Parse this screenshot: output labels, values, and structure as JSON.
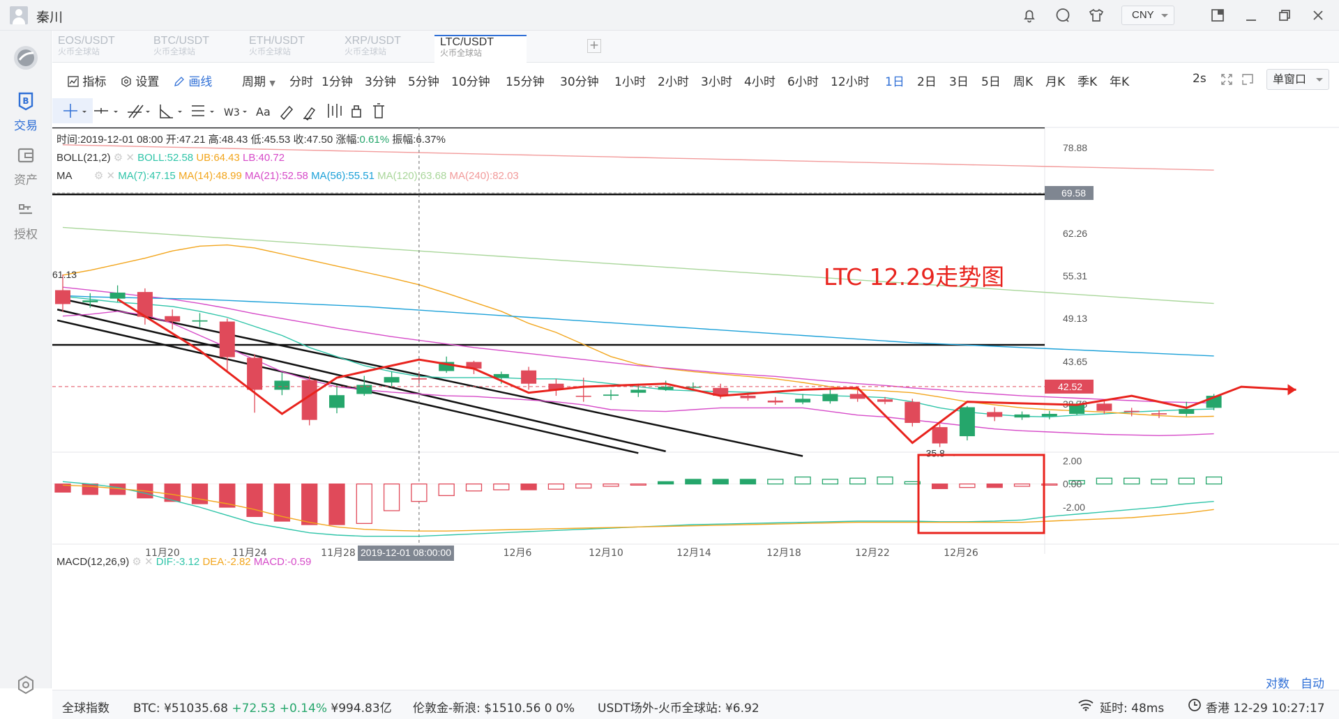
{
  "titlebar": {
    "username": "秦川",
    "currency": "CNY"
  },
  "sidebar": {
    "items": [
      {
        "label": "",
        "icon": "logo-icon"
      },
      {
        "label": "交易",
        "icon": "trade-icon"
      },
      {
        "label": "资产",
        "icon": "wallet-icon"
      },
      {
        "label": "授权",
        "icon": "key-icon"
      },
      {
        "label": "",
        "icon": "settings-hex-icon"
      }
    ]
  },
  "tabs": [
    {
      "pair": "EOS/USDT",
      "exchange": "火币全球站"
    },
    {
      "pair": "BTC/USDT",
      "exchange": "火币全球站"
    },
    {
      "pair": "ETH/USDT",
      "exchange": "火币全球站"
    },
    {
      "pair": "XRP/USDT",
      "exchange": "火币全球站"
    },
    {
      "pair": "LTC/USDT",
      "exchange": "火币全球站"
    }
  ],
  "toolbar": {
    "indicator": "指标",
    "settings": "设置",
    "draw": "画线",
    "period_label": "周期",
    "periods": [
      "分时",
      "1分钟",
      "3分钟",
      "5分钟",
      "10分钟",
      "15分钟",
      "30分钟",
      "1小时",
      "2小时",
      "3小时",
      "4小时",
      "6小时",
      "12小时",
      "1日",
      "2日",
      "3日",
      "5日",
      "周K",
      "月K",
      "季K",
      "年K"
    ],
    "active_period": "1日",
    "refresh": "2s",
    "window_mode": "单窗口"
  },
  "info": {
    "time": "时间:2019-12-01 08:00",
    "open": "开:47.21",
    "high": "高:48.43",
    "low": "低:45.53",
    "close": "收:47.50",
    "change_label": "涨幅:",
    "change": "0.61%",
    "amplitude": "振幅:6.37%"
  },
  "boll": {
    "name": "BOLL(21,2)",
    "boll": "BOLL:52.58",
    "ub": "UB:64.43",
    "lb": "LB:40.72"
  },
  "ma": {
    "name": "MA",
    "values": [
      "MA(7):47.15",
      "MA(14):48.99",
      "MA(21):52.58",
      "MA(56):55.51",
      "MA(120):63.68",
      "MA(240):82.03"
    ]
  },
  "macd": {
    "name": "MACD(12,26,9)",
    "dif": "DIF:-3.12",
    "dea": "DEA:-2.82",
    "macd": "MACD:-0.59"
  },
  "annotation": "LTC 12.29走势图",
  "colors": {
    "up": "#25a66b",
    "down": "#e04a5a",
    "accent": "#2f6fd6",
    "annotation": "#e8231d",
    "ma7": "#2ec4a8",
    "ma14": "#f2a51c",
    "ma21": "#d64ac8",
    "ma56": "#1aa0d8",
    "ma120": "#a9d69a",
    "ma240": "#f29a9a"
  },
  "chart_data": {
    "type": "candlestick",
    "price_axis": [
      "78.88",
      "69.58",
      "62.26",
      "55.31",
      "49.13",
      "43.65",
      "38.78"
    ],
    "current_price": "42.52",
    "macd_axis": [
      "2.00",
      "0.00",
      "-2.00"
    ],
    "x_labels": [
      "11月20",
      "11月24",
      "11月28",
      "12月6",
      "12月10",
      "12月14",
      "12月18",
      "12月22",
      "12月26"
    ],
    "crosshair_time": "2019-12-01 08:00:00",
    "high_label": "61.13",
    "low_label": "35.8 →",
    "ylim": [
      32,
      82
    ],
    "candles": [
      [
        58.5,
        56.2,
        61.1,
        54.9
      ],
      [
        56.5,
        56.8,
        58.0,
        55.6
      ],
      [
        57.1,
        58.1,
        59.3,
        56.5
      ],
      [
        58.2,
        54.1,
        58.8,
        52.8
      ],
      [
        54.2,
        53.3,
        55.3,
        52.0
      ],
      [
        53.3,
        53.5,
        54.7,
        52.4
      ],
      [
        53.3,
        47.4,
        53.8,
        45.1
      ],
      [
        47.3,
        42.0,
        47.9,
        38.2
      ],
      [
        42.0,
        43.5,
        44.8,
        41.1
      ],
      [
        43.6,
        37.0,
        44.3,
        36.1
      ],
      [
        39.0,
        41.1,
        42.8,
        38.1
      ],
      [
        41.3,
        42.8,
        44.3,
        41.0
      ],
      [
        43.2,
        44.1,
        45.0,
        42.4
      ],
      [
        43.9,
        43.7,
        45.0,
        43.0
      ],
      [
        45.1,
        46.6,
        47.5,
        44.8
      ],
      [
        46.6,
        45.5,
        46.8,
        44.6
      ],
      [
        44.0,
        44.6,
        45.0,
        43.0
      ],
      [
        45.2,
        43.0,
        45.8,
        42.0
      ],
      [
        43.0,
        42.0,
        43.8,
        41.0
      ],
      [
        41.0,
        40.9,
        44.0,
        40.0
      ],
      [
        41.0,
        41.2,
        42.0,
        40.3
      ],
      [
        41.5,
        42.0,
        43.0,
        40.8
      ],
      [
        42.0,
        42.5,
        43.5,
        41.8
      ],
      [
        42.5,
        42.5,
        43.2,
        42.0
      ],
      [
        42.3,
        41.0,
        43.0,
        40.5
      ],
      [
        41.0,
        40.6,
        41.5,
        40.2
      ],
      [
        40.2,
        39.9,
        40.8,
        39.5
      ],
      [
        39.9,
        40.5,
        41.3,
        39.6
      ],
      [
        40.1,
        41.3,
        42.0,
        39.7
      ],
      [
        41.3,
        40.5,
        42.0,
        40.0
      ],
      [
        40.4,
        40.0,
        40.8,
        39.6
      ],
      [
        40.0,
        36.5,
        40.5,
        35.9
      ],
      [
        35.8,
        33.1,
        36.3,
        32.5
      ],
      [
        34.3,
        39.1,
        39.3,
        33.6
      ],
      [
        38.3,
        37.5,
        39.1,
        36.8
      ],
      [
        37.4,
        37.9,
        38.4,
        37.0
      ],
      [
        37.6,
        38.0,
        38.5,
        37.1
      ],
      [
        38.0,
        39.7,
        40.0,
        37.8
      ],
      [
        39.7,
        38.5,
        40.1,
        38.0
      ],
      [
        38.5,
        38.3,
        39.0,
        37.6
      ],
      [
        38.1,
        37.9,
        38.6,
        37.3
      ],
      [
        38.0,
        38.8,
        40.0,
        37.6
      ],
      [
        39.0,
        41.0,
        41.3,
        38.6
      ]
    ],
    "series": [
      {
        "name": "MA(7)",
        "values": [
          57.5,
          57.0,
          56.5,
          56.2,
          55.8,
          55.0,
          54.0,
          52.5,
          51.0,
          49.0,
          47.5,
          46.0,
          45.0,
          44.2,
          44.0,
          44.0,
          44.0,
          43.8,
          43.8,
          43.5,
          43.0,
          42.5,
          42.0,
          41.8,
          41.7,
          41.6,
          41.5,
          41.2,
          41.0,
          40.9,
          40.7,
          40.0,
          39.0,
          38.3,
          37.9,
          37.6,
          37.5,
          37.8,
          38.0,
          38.3,
          38.5,
          38.7,
          38.8
        ]
      },
      {
        "name": "MA(14)",
        "values": [
          61.0,
          61.8,
          62.8,
          63.8,
          65.0,
          65.8,
          66.0,
          65.5,
          64.5,
          63.5,
          62.5,
          61.5,
          60.5,
          59.4,
          58.0,
          56.5,
          55.0,
          53.0,
          51.5,
          49.5,
          47.5,
          46.2,
          45.5,
          45.0,
          44.6,
          44.2,
          43.8,
          43.2,
          42.5,
          42.0,
          41.8,
          41.5,
          40.8,
          40.0,
          39.5,
          39.0,
          38.7,
          38.5,
          38.3,
          38.0,
          37.7,
          37.5,
          37.6
        ]
      },
      {
        "name": "MA(21)",
        "values": [
          59.0,
          58.5,
          58.0,
          57.5,
          57.0,
          56.3,
          55.5,
          54.6,
          53.8,
          53.0,
          52.2,
          51.5,
          50.8,
          50.2,
          49.6,
          49.0,
          48.5,
          48.0,
          47.5,
          47.0,
          46.5,
          46.0,
          45.6,
          45.2,
          44.8,
          44.5,
          44.2,
          43.8,
          43.4,
          43.0,
          42.7,
          42.3,
          42.0,
          41.6,
          41.3,
          41.0,
          40.8,
          40.6,
          40.4,
          40.2,
          40.0,
          39.9,
          39.8
        ]
      },
      {
        "name": "MA(56)",
        "values": [
          57.6,
          57.4,
          57.3,
          57.2,
          57.1,
          57.0,
          56.8,
          56.6,
          56.4,
          56.2,
          56.0,
          55.8,
          55.5,
          55.2,
          54.9,
          54.6,
          54.3,
          54.0,
          53.7,
          53.4,
          53.1,
          52.8,
          52.5,
          52.2,
          51.9,
          51.6,
          51.3,
          51.0,
          50.7,
          50.4,
          50.1,
          49.8,
          49.6,
          49.4,
          49.2,
          49.0,
          48.8,
          48.6,
          48.4,
          48.2,
          48.0,
          47.8,
          47.6
        ]
      },
      {
        "name": "MA(120)",
        "values": [
          68.9,
          68.6,
          68.3,
          68.0,
          67.7,
          67.4,
          67.1,
          66.8,
          66.5,
          66.2,
          65.9,
          65.6,
          65.3,
          65.0,
          64.7,
          64.4,
          64.1,
          63.8,
          63.5,
          63.2,
          62.9,
          62.6,
          62.3,
          62.0,
          61.7,
          61.4,
          61.1,
          60.8,
          60.5,
          60.2,
          59.9,
          59.6,
          59.3,
          59.0,
          58.7,
          58.4,
          58.1,
          57.8,
          57.5,
          57.2,
          56.9,
          56.6,
          56.3
        ]
      },
      {
        "name": "MA(240)",
        "values": [
          82.6,
          82.5,
          82.4,
          82.3,
          82.2,
          82.1,
          82.0,
          81.9,
          81.8,
          81.7,
          81.6,
          81.5,
          81.4,
          81.3,
          81.2,
          81.1,
          81.0,
          80.9,
          80.8,
          80.7,
          80.6,
          80.5,
          80.4,
          80.3,
          80.2,
          80.1,
          80.0,
          79.9,
          79.8,
          79.7,
          79.6,
          79.5,
          79.4,
          79.3,
          79.2,
          79.1,
          79.0,
          78.9,
          78.8,
          78.7,
          78.6,
          78.5,
          78.4
        ]
      },
      {
        "name": "LB",
        "values": [
          54.2,
          54.5,
          55.0,
          54.4,
          53.0,
          51.0,
          49.0,
          47.0,
          45.0,
          43.6,
          42.5,
          42.0,
          41.6,
          41.3,
          41.0,
          40.9,
          40.6,
          40.3,
          40.0,
          39.5,
          38.7,
          38.5,
          38.4,
          38.7,
          39.0,
          39.0,
          39.0,
          39.0,
          38.4,
          37.8,
          37.5,
          37.0,
          36.5,
          36.0,
          35.5,
          35.2,
          35.0,
          34.8,
          34.6,
          34.5,
          34.4,
          34.5,
          34.7
        ]
      },
      {
        "name": "DIF",
        "values": [
          0.2,
          0.0,
          -0.3,
          -0.8,
          -1.4,
          -2.0,
          -2.7,
          -3.4,
          -3.8,
          -4.2,
          -4.4,
          -4.5,
          -4.5,
          -4.5,
          -4.4,
          -4.3,
          -4.2,
          -4.1,
          -4.0,
          -3.9,
          -3.8,
          -3.7,
          -3.6,
          -3.5,
          -3.45,
          -3.4,
          -3.35,
          -3.3,
          -3.25,
          -3.2,
          -3.2,
          -3.2,
          -3.25,
          -3.25,
          -3.2,
          -3.1,
          -2.8,
          -2.6,
          -2.4,
          -2.2,
          -2.0,
          -1.7,
          -1.5
        ]
      },
      {
        "name": "DEA",
        "values": [
          -0.1,
          -0.2,
          -0.4,
          -0.6,
          -0.9,
          -1.3,
          -1.7,
          -2.2,
          -2.8,
          -3.3,
          -3.7,
          -3.9,
          -4.0,
          -4.05,
          -4.05,
          -4.0,
          -3.95,
          -3.9,
          -3.85,
          -3.8,
          -3.75,
          -3.7,
          -3.65,
          -3.6,
          -3.55,
          -3.5,
          -3.45,
          -3.4,
          -3.35,
          -3.3,
          -3.3,
          -3.3,
          -3.3,
          -3.3,
          -3.3,
          -3.3,
          -3.2,
          -3.1,
          -3.0,
          -2.9,
          -2.7,
          -2.5,
          -2.2
        ]
      }
    ],
    "macd_bars": [
      -0.7,
      -0.9,
      -0.9,
      -1.2,
      -1.5,
      -1.7,
      -2.0,
      -2.8,
      -3.2,
      -3.5,
      -3.5,
      -3.4,
      -2.3,
      -1.5,
      -1.0,
      -0.6,
      -0.5,
      -0.5,
      -0.45,
      -0.35,
      -0.2,
      -0.1,
      0.2,
      0.4,
      0.4,
      0.4,
      0.4,
      0.6,
      0.4,
      0.5,
      0.6,
      0.2,
      -0.4,
      -0.3,
      -0.3,
      -0.2,
      -0.1,
      0.3,
      0.5,
      0.5,
      0.4,
      0.5,
      0.6,
      0.7,
      1.0,
      1.2
    ],
    "trend_points": [
      [
        3,
        57.0
      ],
      [
        6,
        48.5
      ],
      [
        9,
        38.0
      ],
      [
        11,
        44.0
      ],
      [
        14,
        47.0
      ],
      [
        16,
        45.5
      ],
      [
        18,
        41.5
      ],
      [
        20,
        42.5
      ],
      [
        23,
        43.0
      ],
      [
        25,
        41.0
      ],
      [
        28,
        42.0
      ],
      [
        30,
        42.3
      ],
      [
        32,
        33.2
      ],
      [
        34,
        40.0
      ],
      [
        38,
        39.5
      ],
      [
        40,
        41.0
      ],
      [
        42,
        39.0
      ],
      [
        44,
        42.5
      ],
      [
        46,
        42.0
      ]
    ],
    "lines": [
      [
        -0.2,
        57.2,
        27.0,
        31.0
      ],
      [
        -0.2,
        55.3,
        22.0,
        31.8
      ],
      [
        -0.2,
        53.5,
        21.0,
        31.5
      ]
    ]
  },
  "status": {
    "index": "全球指数",
    "btc_label": "BTC:",
    "btc_price": "¥51035.68",
    "btc_change": "+72.53 +0.14%",
    "btc_volume": "¥994.83亿",
    "gold_label": "伦敦金-新浪:",
    "gold_value": "$1510.56 0 0%",
    "usdt_label": "USDT场外-火币全球站:",
    "usdt_value": "¥6.92",
    "latency_label": "延时:",
    "latency": "48ms",
    "server": "香港 12-29 10:27:17"
  },
  "scale": {
    "log": "对数",
    "auto": "自动"
  }
}
